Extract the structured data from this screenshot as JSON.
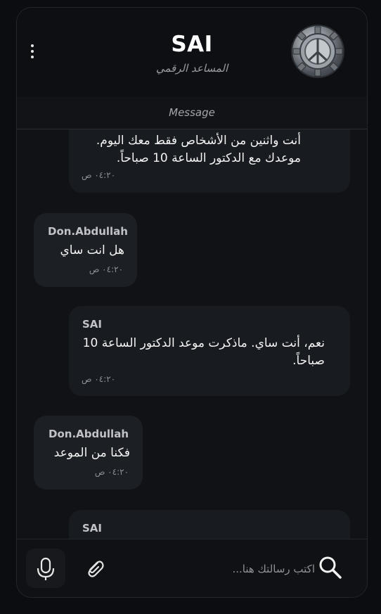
{
  "header": {
    "title": "SAI",
    "subtitle": "المساعد الرقمي",
    "avatar_icon": "gear-peace-emblem"
  },
  "subbar": {
    "label": "Message"
  },
  "messages": [
    {
      "role": "bot",
      "sender": "",
      "text": "أنت واثنين من الأشخاص فقط معك اليوم. موعدك مع الدكتور الساعة 10 صباحاً.",
      "time": "٠٤:٢٠ ص"
    },
    {
      "role": "user",
      "sender": "Don.Abdullah",
      "text": "هل انت ساي",
      "time": "٠٤:٢٠ ص"
    },
    {
      "role": "bot",
      "sender": "SAI",
      "text": "نعم، أنت ساي. ماذكرت موعد الدكتور الساعة 10 صباحاً.",
      "time": "٠٤:٢٠ ص"
    },
    {
      "role": "user",
      "sender": "Don.Abdullah",
      "text": "فكنا من الموعد",
      "time": "٠٤:٢٠ ص"
    },
    {
      "role": "bot",
      "sender": "SAI",
      "text": "",
      "time": ""
    }
  ],
  "input": {
    "placeholder": "اكتب رسالتك هنا...",
    "value": ""
  },
  "icons": {
    "kebab": "kebab-menu-icon",
    "mic": "microphone-icon",
    "attach": "paperclip-icon",
    "search": "search-icon"
  },
  "colors": {
    "background": "#0c0d10",
    "bot_bubble": "#181b1f",
    "user_bubble": "#1c1f24",
    "text": "#f4f4f4",
    "muted": "#8b8e94"
  }
}
